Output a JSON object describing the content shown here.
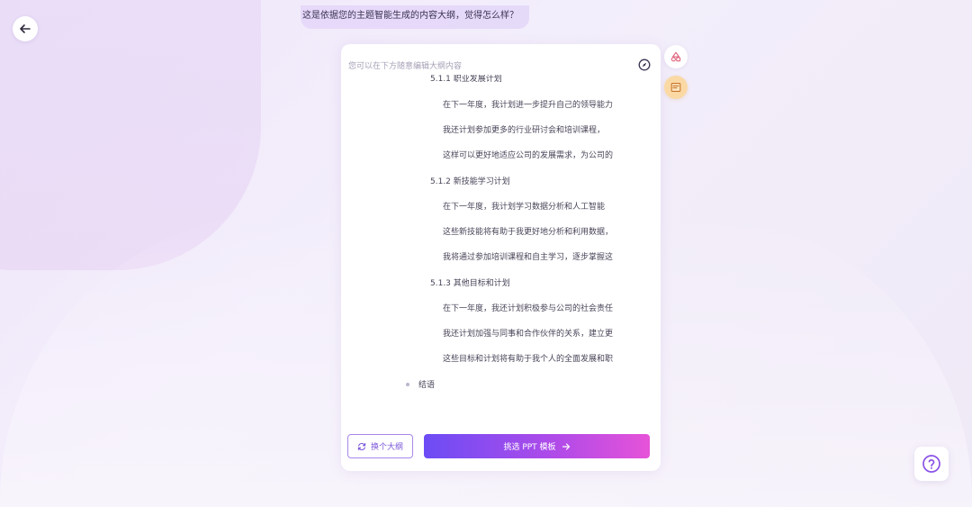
{
  "header": {
    "back_icon": "arrow-left-icon",
    "bubble_text": "这是依据您的主题智能生成的内容大纲，觉得怎么样？"
  },
  "card": {
    "hint": "您可以在下方随意编辑大纲内容",
    "compass_icon": "compass-icon",
    "outline": {
      "cut_heading": "5.1.1 职业发展计划",
      "lines_a": [
        "在下一年度，我计划进一步提升自己的领导能力",
        "我还计划参加更多的行业研讨会和培训课程，",
        "这样可以更好地适应公司的发展需求，为公司的"
      ],
      "heading_2": "5.1.2 新技能学习计划",
      "lines_b": [
        "在下一年度，我计划学习数据分析和人工智能",
        "这些新技能将有助于我更好地分析和利用数据，",
        "我将通过参加培训课程和自主学习，逐步掌握这"
      ],
      "heading_3": "5.1.3 其他目标和计划",
      "lines_c": [
        "在下一年度，我还计划积极参与公司的社会责任",
        "我还计划加强与同事和合作伙伴的关系，建立更",
        "这些目标和计划将有助于我个人的全面发展和职"
      ],
      "top_item": "结语"
    },
    "regen_label": "换个大纲",
    "regen_icon": "refresh-icon",
    "primary_label": "挑选 PPT 模板",
    "primary_icon": "arrow-right-icon"
  },
  "side": {
    "btn1_icon": "shapes-icon",
    "btn2_icon": "note-edit-icon"
  },
  "help": {
    "icon": "help-circle-icon"
  },
  "colors": {
    "accent": "#7b57d9",
    "gradient_start": "#6c4cf5",
    "gradient_end": "#e653d8",
    "background": "#efe6fa"
  }
}
